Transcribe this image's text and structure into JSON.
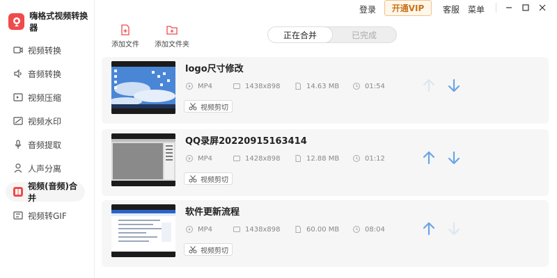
{
  "app": {
    "name": "嗨格式视频转换器"
  },
  "topbar": {
    "login": "登录",
    "vip": "开通VIP",
    "service": "客服",
    "menu": "菜单"
  },
  "toolbar": {
    "add_file": "添加文件",
    "add_folder": "添加文件夹"
  },
  "tabs": [
    {
      "label": "正在合并",
      "active": true
    },
    {
      "label": "已完成",
      "active": false
    }
  ],
  "sidebar": {
    "items": [
      {
        "label": "视频转换",
        "icon": "video-convert-icon",
        "active": false
      },
      {
        "label": "音频转换",
        "icon": "audio-convert-icon",
        "active": false
      },
      {
        "label": "视频压缩",
        "icon": "video-compress-icon",
        "active": false
      },
      {
        "label": "视频水印",
        "icon": "video-watermark-icon",
        "active": false
      },
      {
        "label": "音频提取",
        "icon": "audio-extract-icon",
        "active": false
      },
      {
        "label": "人声分离",
        "icon": "voice-separate-icon",
        "active": false
      },
      {
        "label": "视频(音频)合并",
        "icon": "video-merge-icon",
        "active": true
      },
      {
        "label": "视频转GIF",
        "icon": "video-gif-icon",
        "active": false
      }
    ]
  },
  "files": [
    {
      "title": "logo尺寸修改",
      "format": "MP4",
      "resolution": "1438x898",
      "size": "14.63 MB",
      "duration": "01:54",
      "clip_label": "视频剪切",
      "up_enabled": false,
      "down_enabled": true
    },
    {
      "title": "QQ录屏20220915163414",
      "format": "MP4",
      "resolution": "1428x898",
      "size": "12.88 MB",
      "duration": "01:12",
      "clip_label": "视频剪切",
      "up_enabled": true,
      "down_enabled": true
    },
    {
      "title": "软件更新流程",
      "format": "MP4",
      "resolution": "1438x898",
      "size": "60.00 MB",
      "duration": "08:04",
      "clip_label": "视频剪切",
      "up_enabled": true,
      "down_enabled": false
    }
  ],
  "colors": {
    "accent": "#ef4b4b",
    "arrow_active": "#6aa4e6",
    "arrow_disabled": "#dde6f0",
    "vip": "#c8731a"
  }
}
